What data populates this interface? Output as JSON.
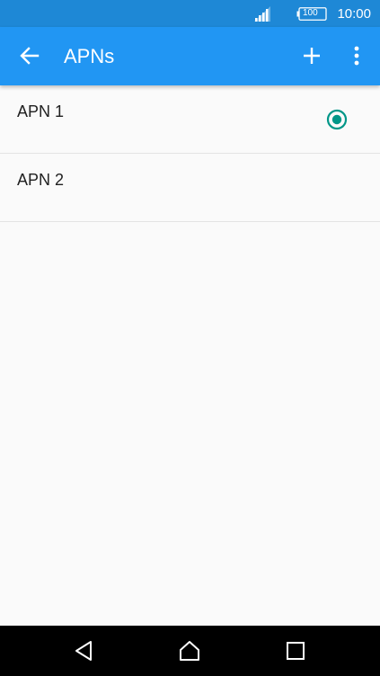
{
  "status_bar": {
    "battery_level": "100",
    "time": "10:00",
    "signal_icon": "signal-strength-icon",
    "battery_icon": "battery-icon"
  },
  "app_bar": {
    "title": "APNs",
    "back_icon": "arrow-left-icon",
    "add_icon": "plus-icon",
    "overflow_icon": "more-vert-icon"
  },
  "apn_list": [
    {
      "name": "APN 1",
      "selected": true
    },
    {
      "name": "APN 2",
      "selected": false
    }
  ],
  "nav_bar": {
    "back_icon": "triangle-back-icon",
    "home_icon": "home-icon",
    "recents_icon": "square-recents-icon"
  },
  "colors": {
    "status_bar": "#1e88d6",
    "app_bar": "#2196f3",
    "radio_accent": "#009688",
    "background": "#fafafa",
    "nav_bar": "#000000"
  }
}
